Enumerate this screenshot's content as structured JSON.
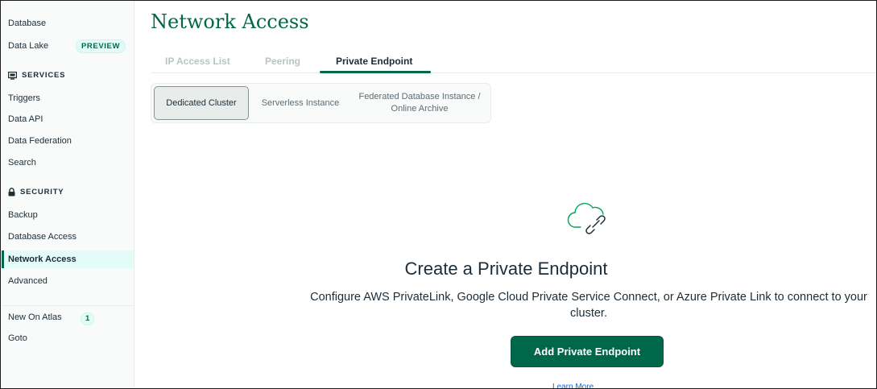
{
  "sidebar": {
    "items_top": [
      {
        "label": "Database"
      },
      {
        "label": "Data Lake",
        "badge": "PREVIEW"
      }
    ],
    "services": {
      "heading": "SERVICES",
      "items": [
        {
          "label": "Triggers"
        },
        {
          "label": "Data API"
        },
        {
          "label": "Data Federation"
        },
        {
          "label": "Search"
        }
      ]
    },
    "security": {
      "heading": "SECURITY",
      "items": [
        {
          "label": "Backup"
        },
        {
          "label": "Database Access"
        },
        {
          "label": "Network Access",
          "active": true
        },
        {
          "label": "Advanced"
        }
      ]
    },
    "bottom": [
      {
        "label": "New On Atlas",
        "badge": "1"
      },
      {
        "label": "Goto"
      }
    ]
  },
  "page": {
    "title": "Network Access"
  },
  "tabs": [
    {
      "label": "IP Access List"
    },
    {
      "label": "Peering"
    },
    {
      "label": "Private Endpoint",
      "active": true
    }
  ],
  "segmented": [
    {
      "label": "Dedicated Cluster",
      "selected": true
    },
    {
      "label": "Serverless Instance"
    },
    {
      "label": "Federated Database Instance / Online Archive"
    }
  ],
  "empty_state": {
    "icon": "cloud-link-icon",
    "title": "Create a Private Endpoint",
    "description": "Configure AWS PrivateLink, Google Cloud Private Service Connect, or Azure Private Link to connect to your cluster.",
    "primary_button": "Add Private Endpoint",
    "link": "Learn More"
  },
  "colors": {
    "brand_green": "#00684a",
    "active_bg": "#e3fcf7",
    "link_blue": "#016bf8"
  }
}
